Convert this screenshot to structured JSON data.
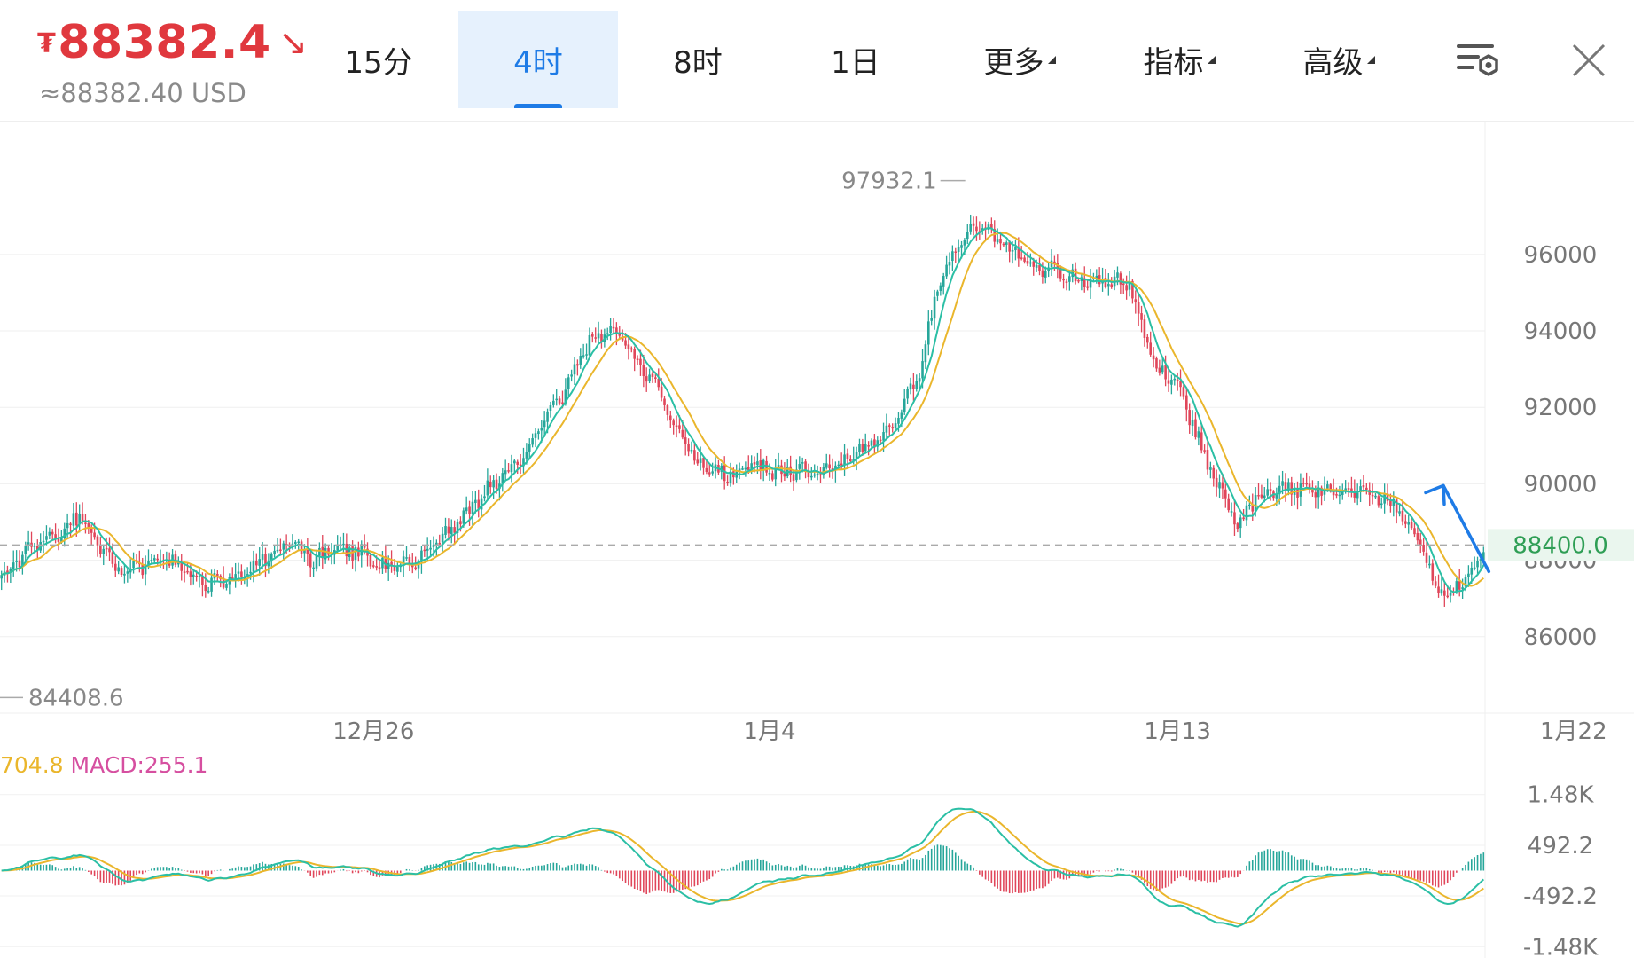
{
  "header": {
    "currency_symbol": "₮",
    "price": "88382.4",
    "price_arrow": "↘",
    "usd_price": "≈88382.40 USD",
    "tabs": [
      {
        "label": "15分",
        "active": false
      },
      {
        "label": "4时",
        "active": true
      },
      {
        "label": "8时",
        "active": false
      },
      {
        "label": "1日",
        "active": false
      },
      {
        "label": "更多",
        "active": false
      },
      {
        "label": "指标",
        "active": false
      },
      {
        "label": "高级",
        "active": false
      }
    ],
    "icons": [
      "chart-settings-icon",
      "close-icon"
    ]
  },
  "colors": {
    "up": "#26a69a",
    "down": "#e0465a",
    "ma_short": "#2bbfa5",
    "ma_long": "#eab62c",
    "dif": "#2bbfa5",
    "dea": "#eab62c",
    "price_red": "#e0383e",
    "accent_blue": "#1e7be6",
    "current_price_tag": "#2f9e55"
  },
  "chart_data": [
    {
      "type": "candlestick",
      "x_ticks": [
        "12月26",
        "1月4",
        "1月13",
        "1月22"
      ],
      "y_ticks": [
        86000,
        88000,
        90000,
        92000,
        94000,
        96000
      ],
      "ylim": [
        84000,
        99500
      ],
      "high_label": "97932.1",
      "low_label": "84408.6",
      "current_price_label": "88400.0",
      "current_price": 88400,
      "grid": true,
      "anchors": [
        [
          0,
          87500
        ],
        [
          6,
          88000
        ],
        [
          12,
          88500
        ],
        [
          20,
          88700
        ],
        [
          26,
          89200
        ],
        [
          34,
          88300
        ],
        [
          40,
          87600
        ],
        [
          48,
          87900
        ],
        [
          56,
          88000
        ],
        [
          64,
          87500
        ],
        [
          72,
          87400
        ],
        [
          80,
          87700
        ],
        [
          90,
          88100
        ],
        [
          96,
          88400
        ],
        [
          104,
          88000
        ],
        [
          112,
          88300
        ],
        [
          120,
          88200
        ],
        [
          128,
          87800
        ],
        [
          136,
          87900
        ],
        [
          144,
          88400
        ],
        [
          154,
          89100
        ],
        [
          162,
          89900
        ],
        [
          172,
          90500
        ],
        [
          180,
          91700
        ],
        [
          186,
          92200
        ],
        [
          196,
          93700
        ],
        [
          204,
          94000
        ],
        [
          210,
          93400
        ],
        [
          218,
          92500
        ],
        [
          226,
          91200
        ],
        [
          234,
          90400
        ],
        [
          242,
          90200
        ],
        [
          250,
          90500
        ],
        [
          260,
          90300
        ],
        [
          268,
          90300
        ],
        [
          278,
          90400
        ],
        [
          288,
          91000
        ],
        [
          296,
          91500
        ],
        [
          306,
          92800
        ],
        [
          312,
          95200
        ],
        [
          318,
          96200
        ],
        [
          324,
          96800
        ],
        [
          332,
          96400
        ],
        [
          342,
          95800
        ],
        [
          350,
          95600
        ],
        [
          360,
          95300
        ],
        [
          370,
          95300
        ],
        [
          376,
          95200
        ],
        [
          384,
          93100
        ],
        [
          392,
          92700
        ],
        [
          400,
          90900
        ],
        [
          408,
          89500
        ],
        [
          412,
          88900
        ],
        [
          418,
          89600
        ],
        [
          426,
          89900
        ],
        [
          436,
          89800
        ],
        [
          446,
          89900
        ],
        [
          456,
          89800
        ],
        [
          464,
          89400
        ],
        [
          472,
          88600
        ],
        [
          478,
          87300
        ],
        [
          482,
          87100
        ],
        [
          490,
          87700
        ],
        [
          494,
          88300
        ]
      ]
    },
    {
      "type": "macd",
      "legend_value": "704.8",
      "macd_label": "MACD:255.1",
      "y_ticks": [
        "1.48K",
        "492.2",
        "-492.2",
        "-1.48K"
      ],
      "ylim": [
        -1700,
        2200
      ]
    }
  ]
}
